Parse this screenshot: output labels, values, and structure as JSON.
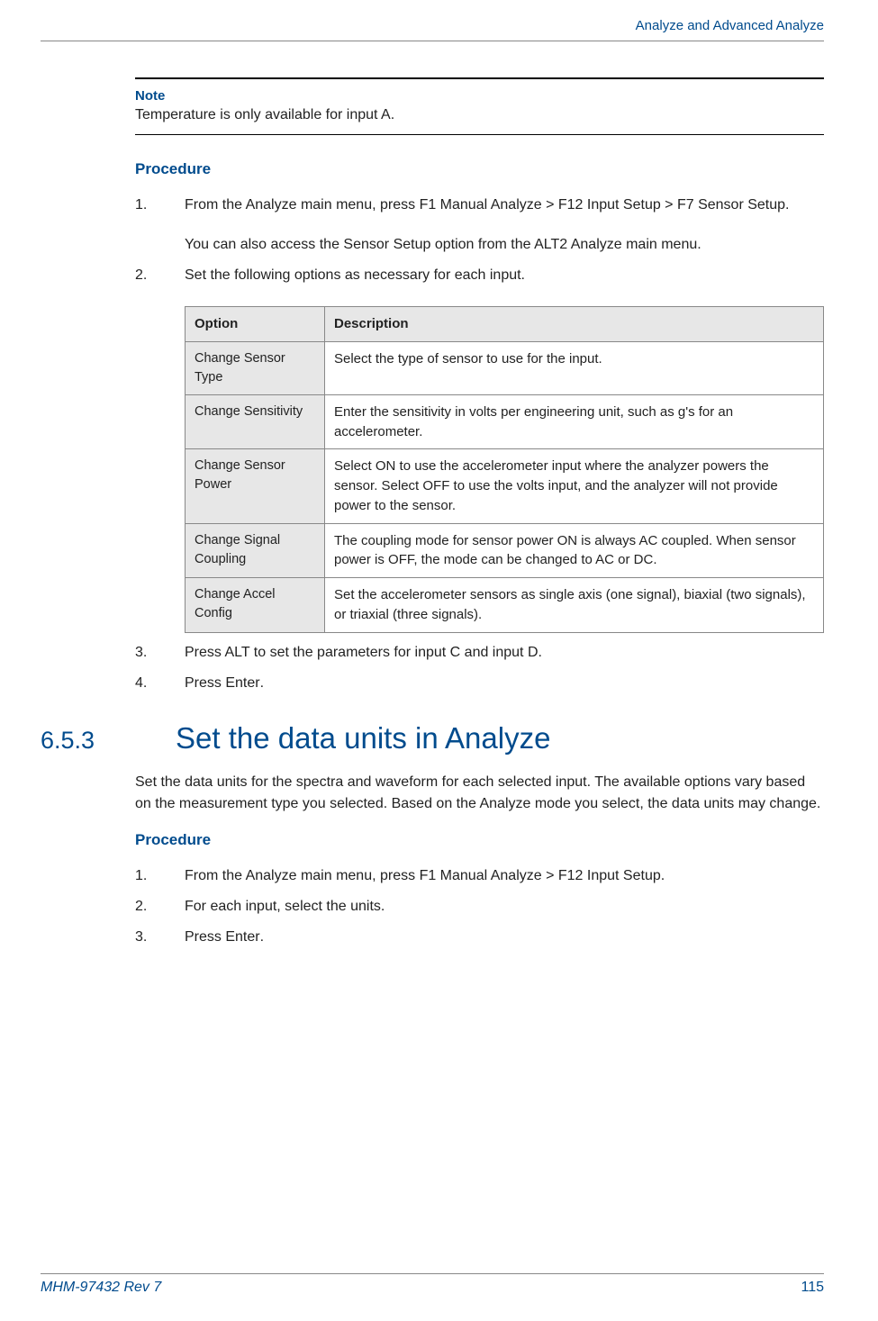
{
  "header": {
    "title": "Analyze and Advanced Analyze"
  },
  "note": {
    "label": "Note",
    "text": "Temperature is only available for input A."
  },
  "proc1": {
    "heading": "Procedure",
    "steps": {
      "s1a": "From the Analyze main menu, press ",
      "s1b": "F1 Manual Analyze",
      "s1c": " > ",
      "s1d": "F12 Input Setup",
      "s1e": " > ",
      "s1f": "F7 Sensor Setup",
      "s1g": ".",
      "s1sub_a": "You can also access the ",
      "s1sub_b": "Sensor Setup",
      "s1sub_c": " option from the ALT2 Analyze main menu.",
      "s2": "Set the following options as necessary for each input.",
      "s3": "Press ALT to set the parameters for input C and input D.",
      "s4a": "Press ",
      "s4b": "Enter",
      "s4c": "."
    }
  },
  "table": {
    "h1": "Option",
    "h2": "Description",
    "rows": [
      {
        "opt": "Change Sensor Type",
        "desc": "Select the type of sensor to use for the input."
      },
      {
        "opt": "Change Sensitivity",
        "desc": "Enter the sensitivity in volts per engineering unit, such as g's for an accelerometer."
      },
      {
        "opt": "Change Sensor Power",
        "desc": "Select ON to use the accelerometer input where the analyzer powers the sensor. Select OFF to use the volts input, and the analyzer will not provide power to the sensor."
      },
      {
        "opt": "Change Signal Coupling",
        "desc": "The coupling mode for sensor power ON is always AC coupled. When sensor power is OFF, the mode can be changed to AC or DC."
      },
      {
        "opt": "Change Accel Config",
        "desc": "Set the accelerometer sensors as single axis (one signal), biaxial (two signals), or triaxial (three signals)."
      }
    ]
  },
  "section": {
    "num": "6.5.3",
    "title": "Set the data units in Analyze",
    "body": "Set the data units for the spectra and waveform for each selected input. The available options vary based on the measurement type you selected. Based on the Analyze mode you select, the data units may change."
  },
  "proc2": {
    "heading": "Procedure",
    "steps": {
      "s1a": "From the Analyze main menu, press ",
      "s1b": "F1 Manual Analyze",
      "s1c": " > ",
      "s1d": "F12 Input Setup",
      "s1e": ".",
      "s2": "For each input, select the units.",
      "s3a": "Press ",
      "s3b": "Enter",
      "s3c": "."
    }
  },
  "footer": {
    "doc": "MHM-97432 Rev 7",
    "page": "115"
  }
}
